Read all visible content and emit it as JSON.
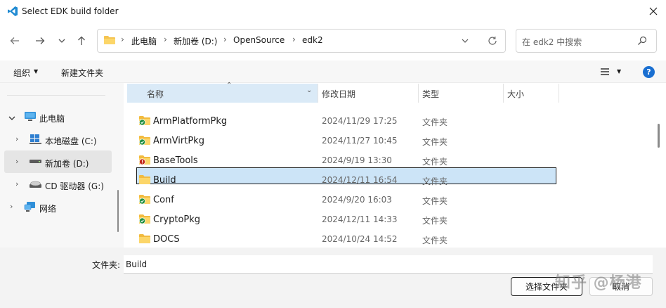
{
  "window": {
    "title": "Select EDK build folder",
    "close_icon": "close-icon"
  },
  "address": {
    "crumbs": [
      "此电脑",
      "新加卷 (D:)",
      "OpenSource",
      "edk2"
    ]
  },
  "search": {
    "placeholder": "在 edk2 中搜索"
  },
  "toolbar": {
    "organize_label": "组织",
    "new_folder_label": "新建文件夹"
  },
  "nav": {
    "items": [
      {
        "label": "此电脑",
        "icon": "computer-icon"
      },
      {
        "label": "本地磁盘 (C:)",
        "icon": "windows-drive-icon"
      },
      {
        "label": "新加卷 (D:)",
        "icon": "drive-icon",
        "selected": true
      },
      {
        "label": "CD 驱动器 (G:)",
        "icon": "cd-drive-icon"
      },
      {
        "label": "网络",
        "icon": "network-icon"
      }
    ]
  },
  "columns": {
    "name": "名称",
    "modified": "修改日期",
    "type": "类型",
    "size": "大小"
  },
  "files": [
    {
      "name": "ArmPlatformPkg",
      "date": "2024/11/29 17:25",
      "type": "文件夹",
      "status": "synced"
    },
    {
      "name": "ArmVirtPkg",
      "date": "2024/11/27 10:45",
      "type": "文件夹",
      "status": "synced"
    },
    {
      "name": "BaseTools",
      "date": "2024/9/19 13:30",
      "type": "文件夹",
      "status": "error"
    },
    {
      "name": "Build",
      "date": "2024/12/11 16:54",
      "type": "文件夹",
      "status": "none",
      "selected": true
    },
    {
      "name": "Conf",
      "date": "2024/9/20 16:03",
      "type": "文件夹",
      "status": "synced"
    },
    {
      "name": "CryptoPkg",
      "date": "2024/12/11 14:33",
      "type": "文件夹",
      "status": "synced"
    },
    {
      "name": "DOCS",
      "date": "2024/10/24 14:52",
      "type": "文件夹",
      "status": "none"
    }
  ],
  "footer": {
    "filename_label": "文件夹:",
    "filename_value": "Build",
    "select_button": "选择文件夹",
    "cancel_button": "取消"
  },
  "watermark": "知乎 @杨港"
}
